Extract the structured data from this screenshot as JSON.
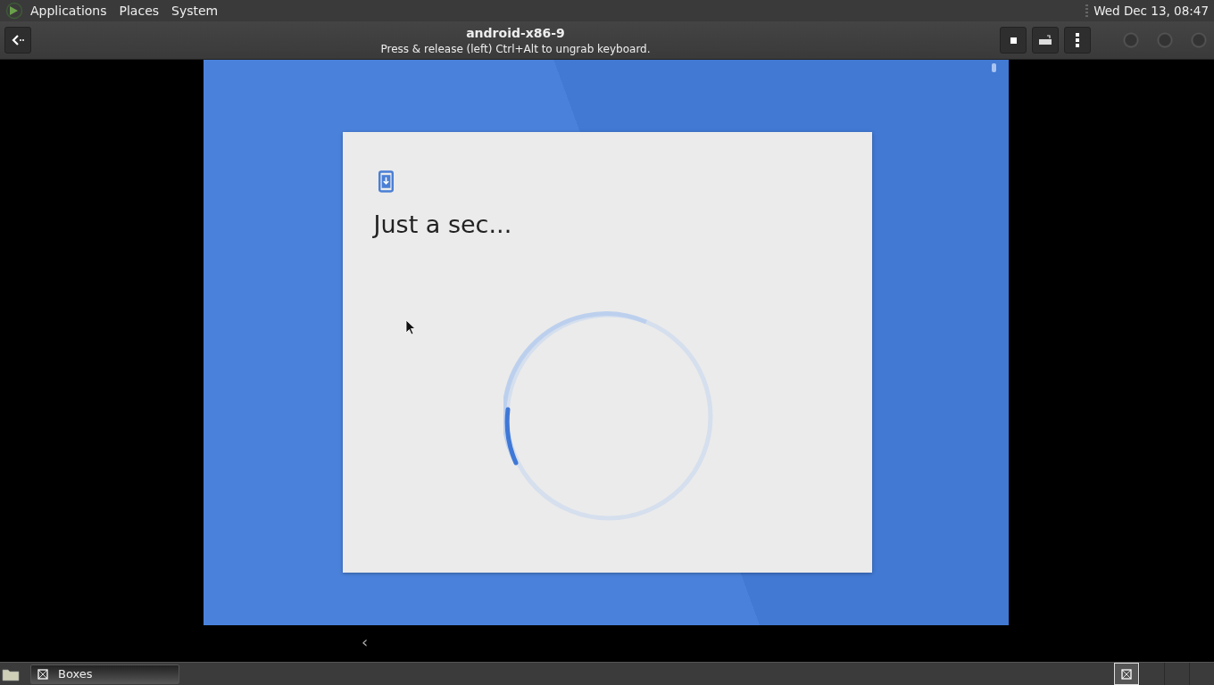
{
  "top_panel": {
    "menus": [
      "Applications",
      "Places",
      "System"
    ],
    "clock": "Wed Dec 13, 08:47"
  },
  "header_bar": {
    "title": "android-x86-9",
    "subtitle": "Press & release (left) Ctrl+Alt to ungrab keyboard."
  },
  "android_screen": {
    "dialog": {
      "title": "Just a sec..."
    },
    "nav_back": "‹"
  },
  "taskbar": {
    "windows": [
      {
        "label": "Boxes",
        "selected": false
      }
    ],
    "workspaces": [
      {
        "selected": true
      },
      {
        "selected": false
      },
      {
        "selected": false
      },
      {
        "selected": false
      }
    ]
  }
}
